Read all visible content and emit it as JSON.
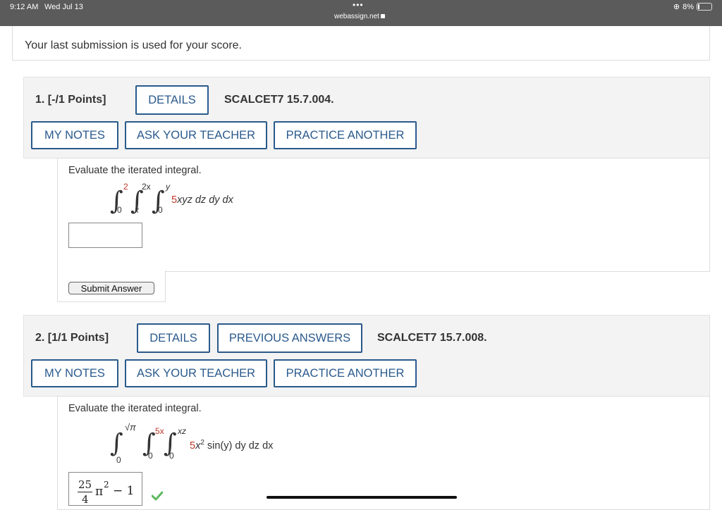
{
  "status_bar": {
    "time": "9:12 AM",
    "date": "Wed Jul 13",
    "url": "webassign.net",
    "battery": "8%"
  },
  "notice": "Your last submission is used for your score.",
  "questions": [
    {
      "number": "1.",
      "points": "[-/1 Points]",
      "details_label": "DETAILS",
      "code": "SCALCET7 15.7.004.",
      "my_notes_label": "MY NOTES",
      "ask_teacher_label": "ASK YOUR TEACHER",
      "practice_label": "PRACTICE ANOTHER",
      "prompt": "Evaluate the iterated integral.",
      "limits": {
        "outer_upper": "2",
        "outer_lower": "0",
        "middle_upper": "2x",
        "middle_lower": "x",
        "inner_upper": "y",
        "inner_lower": "0"
      },
      "integrand_coef": "5",
      "integrand_rest": "xyz dz dy dx",
      "answer_value": "",
      "submit_label": "Submit Answer"
    },
    {
      "number": "2.",
      "points": "[1/1 Points]",
      "details_label": "DETAILS",
      "previous_answers_label": "PREVIOUS ANSWERS",
      "code": "SCALCET7 15.7.008.",
      "my_notes_label": "MY NOTES",
      "ask_teacher_label": "ASK YOUR TEACHER",
      "practice_label": "PRACTICE ANOTHER",
      "prompt": "Evaluate the iterated integral.",
      "limits": {
        "outer_upper": "√π",
        "outer_lower": "0",
        "middle_upper": "5x",
        "middle_lower": "0",
        "inner_upper": "xz",
        "inner_lower": "0"
      },
      "integrand_coef": "5",
      "integrand_mid": "x",
      "integrand_exp": "2",
      "integrand_rest": " sin(y) dy dz dx",
      "answer_numerator": "25",
      "answer_denominator": "4",
      "answer_pi": "π",
      "answer_pi_exp": "2",
      "answer_tail": "− 1",
      "status_icon": "check-icon",
      "status_color": "#5cb85c"
    }
  ]
}
